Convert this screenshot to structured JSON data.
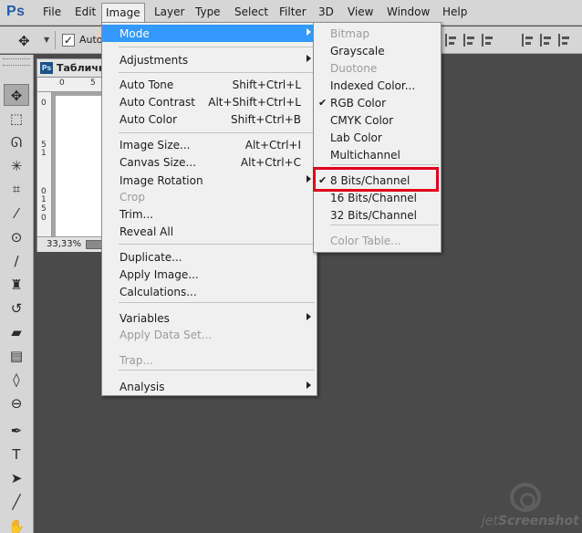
{
  "app": {
    "logo": "Ps",
    "menus": [
      "File",
      "Edit",
      "Image",
      "Layer",
      "Type",
      "Select",
      "Filter",
      "3D",
      "View",
      "Window",
      "Help"
    ],
    "active_menu": "Image"
  },
  "options_bar": {
    "tool_icon": "move-tool-icon",
    "auto_select_label": "Auto-",
    "auto_select_checked": "✓"
  },
  "toolbar": {
    "tools": [
      {
        "name": "move-tool-icon",
        "glyph": "✥"
      },
      {
        "name": "marquee-tool-icon",
        "glyph": "⬚"
      },
      {
        "name": "lasso-tool-icon",
        "glyph": "ᘏ"
      },
      {
        "name": "magic-wand-tool-icon",
        "glyph": "✳"
      },
      {
        "name": "crop-tool-icon",
        "glyph": "⌗"
      },
      {
        "name": "eyedropper-tool-icon",
        "glyph": "⁄"
      },
      {
        "name": "spot-healing-tool-icon",
        "glyph": "⊙"
      },
      {
        "name": "brush-tool-icon",
        "glyph": "∕"
      },
      {
        "name": "clone-stamp-tool-icon",
        "glyph": "♜"
      },
      {
        "name": "history-brush-tool-icon",
        "glyph": "↺"
      },
      {
        "name": "eraser-tool-icon",
        "glyph": "▰"
      },
      {
        "name": "gradient-tool-icon",
        "glyph": "▤"
      },
      {
        "name": "blur-tool-icon",
        "glyph": "◊"
      },
      {
        "name": "dodge-tool-icon",
        "glyph": "⊖"
      },
      {
        "name": "pen-tool-icon",
        "glyph": "✒"
      },
      {
        "name": "type-tool-icon",
        "glyph": "T"
      },
      {
        "name": "path-selection-tool-icon",
        "glyph": "➤"
      },
      {
        "name": "line-tool-icon",
        "glyph": "╱"
      },
      {
        "name": "hand-tool-icon",
        "glyph": "✋"
      }
    ]
  },
  "document": {
    "title": "Таблички",
    "zoom": "33,33%",
    "ruler_top": [
      "0",
      "5"
    ],
    "ruler_left": [
      "0",
      "5",
      "1",
      "0",
      "1",
      "5",
      "0"
    ]
  },
  "image_menu": {
    "items": [
      {
        "label": "Mode",
        "shortcut": "",
        "submenu": true,
        "highlight": true,
        "disabled": false
      },
      {
        "label": "Adjustments",
        "shortcut": "",
        "submenu": true,
        "highlight": false,
        "disabled": false
      },
      {
        "label": "Auto Tone",
        "shortcut": "Shift+Ctrl+L",
        "submenu": false,
        "highlight": false,
        "disabled": false
      },
      {
        "label": "Auto Contrast",
        "shortcut": "Alt+Shift+Ctrl+L",
        "submenu": false,
        "highlight": false,
        "disabled": false
      },
      {
        "label": "Auto Color",
        "shortcut": "Shift+Ctrl+B",
        "submenu": false,
        "highlight": false,
        "disabled": false
      },
      {
        "label": "Image Size...",
        "shortcut": "Alt+Ctrl+I",
        "submenu": false,
        "highlight": false,
        "disabled": false
      },
      {
        "label": "Canvas Size...",
        "shortcut": "Alt+Ctrl+C",
        "submenu": false,
        "highlight": false,
        "disabled": false
      },
      {
        "label": "Image Rotation",
        "shortcut": "",
        "submenu": true,
        "highlight": false,
        "disabled": false
      },
      {
        "label": "Crop",
        "shortcut": "",
        "submenu": false,
        "highlight": false,
        "disabled": true
      },
      {
        "label": "Trim...",
        "shortcut": "",
        "submenu": false,
        "highlight": false,
        "disabled": false
      },
      {
        "label": "Reveal All",
        "shortcut": "",
        "submenu": false,
        "highlight": false,
        "disabled": false
      },
      {
        "label": "Duplicate...",
        "shortcut": "",
        "submenu": false,
        "highlight": false,
        "disabled": false
      },
      {
        "label": "Apply Image...",
        "shortcut": "",
        "submenu": false,
        "highlight": false,
        "disabled": false
      },
      {
        "label": "Calculations...",
        "shortcut": "",
        "submenu": false,
        "highlight": false,
        "disabled": false
      },
      {
        "label": "Variables",
        "shortcut": "",
        "submenu": true,
        "highlight": false,
        "disabled": false
      },
      {
        "label": "Apply Data Set...",
        "shortcut": "",
        "submenu": false,
        "highlight": false,
        "disabled": true
      },
      {
        "label": "Trap...",
        "shortcut": "",
        "submenu": false,
        "highlight": false,
        "disabled": true
      },
      {
        "label": "Analysis",
        "shortcut": "",
        "submenu": true,
        "highlight": false,
        "disabled": false
      }
    ]
  },
  "mode_menu": {
    "items": [
      {
        "label": "Bitmap",
        "checked": false,
        "disabled": true
      },
      {
        "label": "Grayscale",
        "checked": false,
        "disabled": false
      },
      {
        "label": "Duotone",
        "checked": false,
        "disabled": true
      },
      {
        "label": "Indexed Color...",
        "checked": false,
        "disabled": false
      },
      {
        "label": "RGB Color",
        "checked": true,
        "disabled": false
      },
      {
        "label": "CMYK Color",
        "checked": false,
        "disabled": false
      },
      {
        "label": "Lab Color",
        "checked": false,
        "disabled": false
      },
      {
        "label": "Multichannel",
        "checked": false,
        "disabled": false
      },
      {
        "label": "8 Bits/Channel",
        "checked": true,
        "disabled": false
      },
      {
        "label": "16 Bits/Channel",
        "checked": false,
        "disabled": false
      },
      {
        "label": "32 Bits/Channel",
        "checked": false,
        "disabled": false
      },
      {
        "label": "Color Table...",
        "checked": false,
        "disabled": true
      }
    ],
    "check_glyph": "✔",
    "highlighted_item": "8 Bits/Channel"
  },
  "watermark": {
    "text_a": "jet",
    "text_b": "Screenshot"
  },
  "colors": {
    "accent_highlight": "#3399ff",
    "annotation_red": "#e0001b",
    "ps_blue": "#1f5ca8"
  }
}
